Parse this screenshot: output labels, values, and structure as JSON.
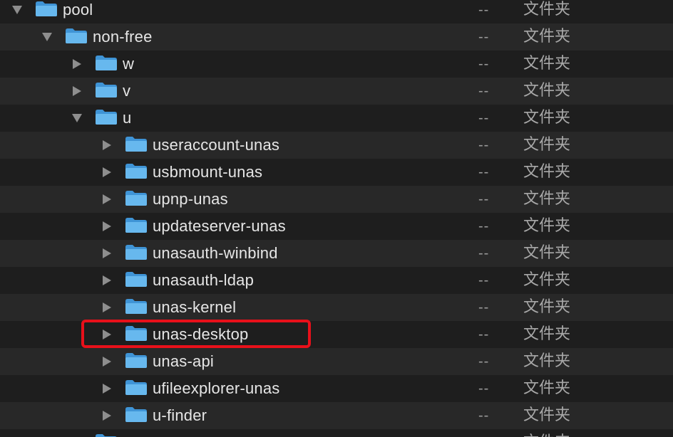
{
  "rows": [
    {
      "name": "pool",
      "size": "--",
      "kind": "文件夹",
      "depth": 0,
      "expanded": true
    },
    {
      "name": "non-free",
      "size": "--",
      "kind": "文件夹",
      "depth": 1,
      "expanded": true
    },
    {
      "name": "w",
      "size": "--",
      "kind": "文件夹",
      "depth": 2,
      "expanded": false
    },
    {
      "name": "v",
      "size": "--",
      "kind": "文件夹",
      "depth": 2,
      "expanded": false
    },
    {
      "name": "u",
      "size": "--",
      "kind": "文件夹",
      "depth": 2,
      "expanded": true
    },
    {
      "name": "useraccount-unas",
      "size": "--",
      "kind": "文件夹",
      "depth": 3,
      "expanded": false
    },
    {
      "name": "usbmount-unas",
      "size": "--",
      "kind": "文件夹",
      "depth": 3,
      "expanded": false
    },
    {
      "name": "upnp-unas",
      "size": "--",
      "kind": "文件夹",
      "depth": 3,
      "expanded": false
    },
    {
      "name": "updateserver-unas",
      "size": "--",
      "kind": "文件夹",
      "depth": 3,
      "expanded": false
    },
    {
      "name": "unasauth-winbind",
      "size": "--",
      "kind": "文件夹",
      "depth": 3,
      "expanded": false
    },
    {
      "name": "unasauth-ldap",
      "size": "--",
      "kind": "文件夹",
      "depth": 3,
      "expanded": false
    },
    {
      "name": "unas-kernel",
      "size": "--",
      "kind": "文件夹",
      "depth": 3,
      "expanded": false
    },
    {
      "name": "unas-desktop",
      "size": "--",
      "kind": "文件夹",
      "depth": 3,
      "expanded": false,
      "highlighted": true
    },
    {
      "name": "unas-api",
      "size": "--",
      "kind": "文件夹",
      "depth": 3,
      "expanded": false
    },
    {
      "name": "ufileexplorer-unas",
      "size": "--",
      "kind": "文件夹",
      "depth": 3,
      "expanded": false
    },
    {
      "name": "u-finder",
      "size": "--",
      "kind": "文件夹",
      "depth": 3,
      "expanded": false
    },
    {
      "name": "",
      "size": "",
      "kind": "文件夹",
      "depth": 2,
      "expanded": false
    }
  ],
  "colors": {
    "folder_light": "#67b8ee",
    "folder_dark": "#3f94d6",
    "highlight_border": "#e8101a",
    "row_even": "#1e1e1e",
    "row_odd": "#282828"
  },
  "icons": {
    "expanded": "disclosure-triangle-down-icon",
    "collapsed": "disclosure-triangle-right-icon",
    "folder": "folder-icon"
  }
}
